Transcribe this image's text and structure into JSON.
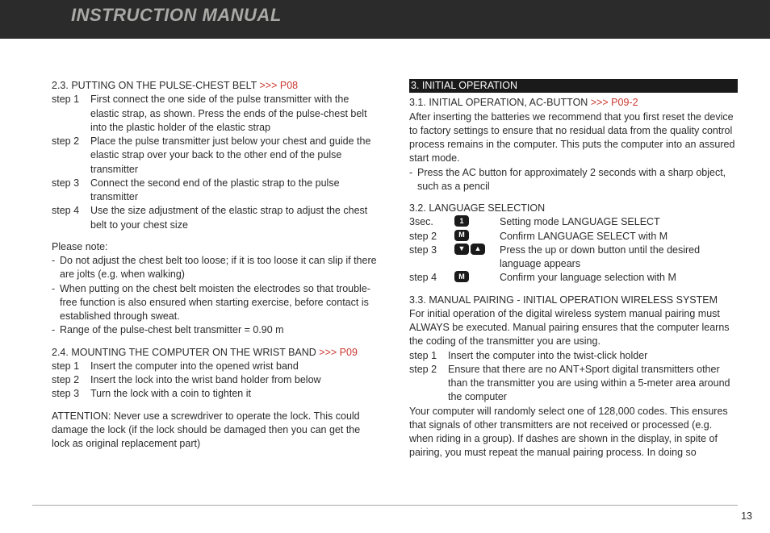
{
  "header": {
    "title": "INSTRUCTION MANUAL"
  },
  "page_number": "13",
  "left": {
    "s23": {
      "heading_num": "2.3. PUTTING ON THE PULSE-CHEST BELT ",
      "heading_ref": ">>> P08",
      "steps": [
        {
          "label": "step 1",
          "text": "First connect the one side of the pulse transmitter with the elastic strap, as shown. Press the ends of the pulse-chest belt into the plastic holder of the elastic strap"
        },
        {
          "label": "step 2",
          "text": "Place the pulse transmitter just below your chest and guide the elastic strap over your back to the other end of the pulse transmitter"
        },
        {
          "label": "step 3",
          "text": "Connect the second end of the plastic strap to the pulse transmitter"
        },
        {
          "label": "step 4",
          "text": "Use the size adjustment of the elastic strap to adjust the chest belt to your chest size"
        }
      ],
      "note_label": "Please note:",
      "notes": [
        "Do not adjust the chest belt too loose; if it is too loose it can slip if there are jolts (e.g. when walking)",
        "When putting on the chest belt moisten the electrodes so that trouble-free function is also ensured when starting exercise, before contact is established through sweat.",
        "Range of the pulse-chest belt transmitter = 0.90 m"
      ]
    },
    "s24": {
      "heading_num": "2.4. MOUNTING THE COMPUTER ON THE WRIST BAND ",
      "heading_ref": ">>> P09",
      "steps": [
        {
          "label": "step 1",
          "text": "Insert the computer into the opened wrist band"
        },
        {
          "label": "step 2",
          "text": "Insert the lock into the wrist band holder from below"
        },
        {
          "label": "step 3",
          "text": "Turn the lock with a coin to tighten it"
        }
      ],
      "attention": "ATTENTION: Never use a screwdriver to operate the lock. This could damage the lock (if the lock should be damaged then you can get the lock as original replacement part)"
    }
  },
  "right": {
    "s3bar": " 3. INITIAL OPERATION ",
    "s31": {
      "heading_num": "3.1. INITIAL OPERATION, AC-BUTTON ",
      "heading_ref": ">>> P09-2",
      "para": "After inserting the batteries we recommend that you first reset the device to factory settings to ensure that no residual data from the quality control process remains in the computer. This puts the computer into an assured start mode.",
      "note": "Press the AC button for approximately 2 seconds with a sharp object, such as a pencil"
    },
    "s32": {
      "heading": "3.2. LANGUAGE SELECTION",
      "rows": [
        {
          "label": "3sec.",
          "icons": [
            "1"
          ],
          "text": "Setting mode LANGUAGE SELECT"
        },
        {
          "label": "step 2",
          "icons": [
            "M"
          ],
          "text": "Confirm LANGUAGE SELECT with M"
        },
        {
          "label": "step 3",
          "icons": [
            "▼",
            "▲"
          ],
          "text": "Press the up or down button until the desired language appears"
        },
        {
          "label": "step 4",
          "icons": [
            "M"
          ],
          "text": "Confirm your language selection with M"
        }
      ]
    },
    "s33": {
      "heading": "3.3. MANUAL PAIRING - INITIAL OPERATION WIRELESS SYSTEM",
      "para1": "For initial operation of the digital wireless system manual pairing must ALWAYS be executed. Manual pairing ensures that the computer learns the coding of the transmitter you are using.",
      "steps": [
        {
          "label": "step 1",
          "text": "Insert the computer into the twist-click holder"
        },
        {
          "label": "step 2",
          "text": "Ensure that there are no ANT+Sport digital transmitters other than the transmitter you are using within a 5-meter area around the computer"
        }
      ],
      "para2": "Your computer will randomly select one of 128,000 codes. This ensures that signals of other transmitters are not received or processed (e.g. when riding in a group). If dashes are shown in the display, in spite of pairing, you must repeat the manual pairing process. In doing so"
    }
  }
}
